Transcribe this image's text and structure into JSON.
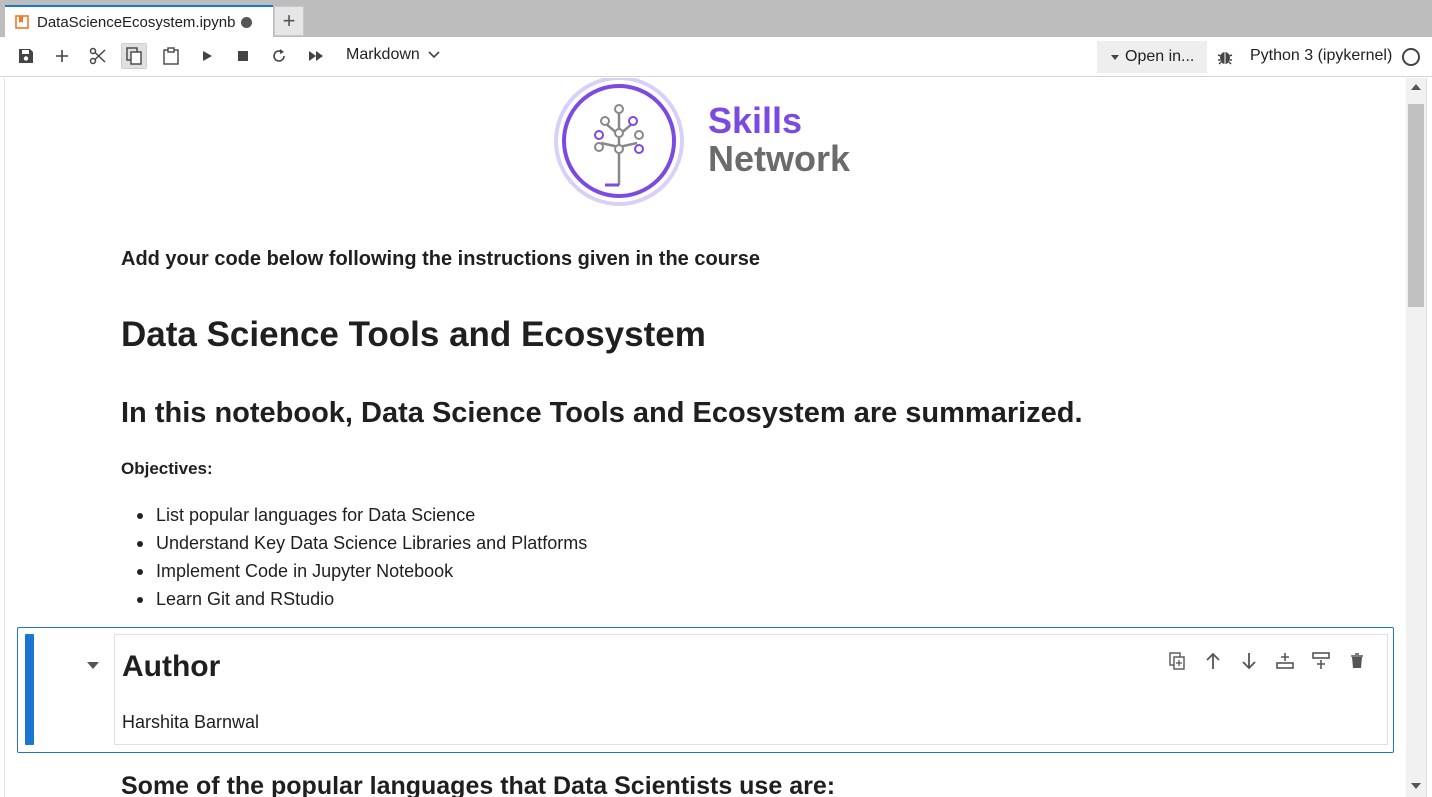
{
  "tab": {
    "title": "DataScienceEcosystem.ipynb",
    "new_tab_label": "+"
  },
  "toolbar": {
    "cell_type": "Markdown",
    "open_in": "Open in...",
    "kernel": "Python 3 (ipykernel)",
    "icons": [
      "save-icon",
      "add-icon",
      "cut-icon",
      "copy-icon",
      "paste-icon",
      "run-icon",
      "stop-icon",
      "restart-icon",
      "fast-forward-icon"
    ]
  },
  "logo": {
    "line1": "Skills",
    "line2": "Network",
    "colors": {
      "purple": "#7b4ae2",
      "gray": "#6b6b6b"
    }
  },
  "notebook": {
    "intro": "Add your code below following the instructions given in the course",
    "title": "Data Science Tools and Ecosystem",
    "summary": "In this notebook, Data Science Tools and Ecosystem are summarized.",
    "objectives_label": "Objectives:",
    "objectives": [
      "List popular languages for Data Science",
      "Understand Key Data Science Libraries and Platforms",
      "Implement Code in Jupyter Notebook",
      "Learn Git and RStudio"
    ],
    "author_heading": "Author",
    "author_name": "Harshita Barnwal",
    "next_heading": "Some of the popular languages that Data Scientists use are:"
  },
  "colors": {
    "accent": "#1976d2"
  }
}
